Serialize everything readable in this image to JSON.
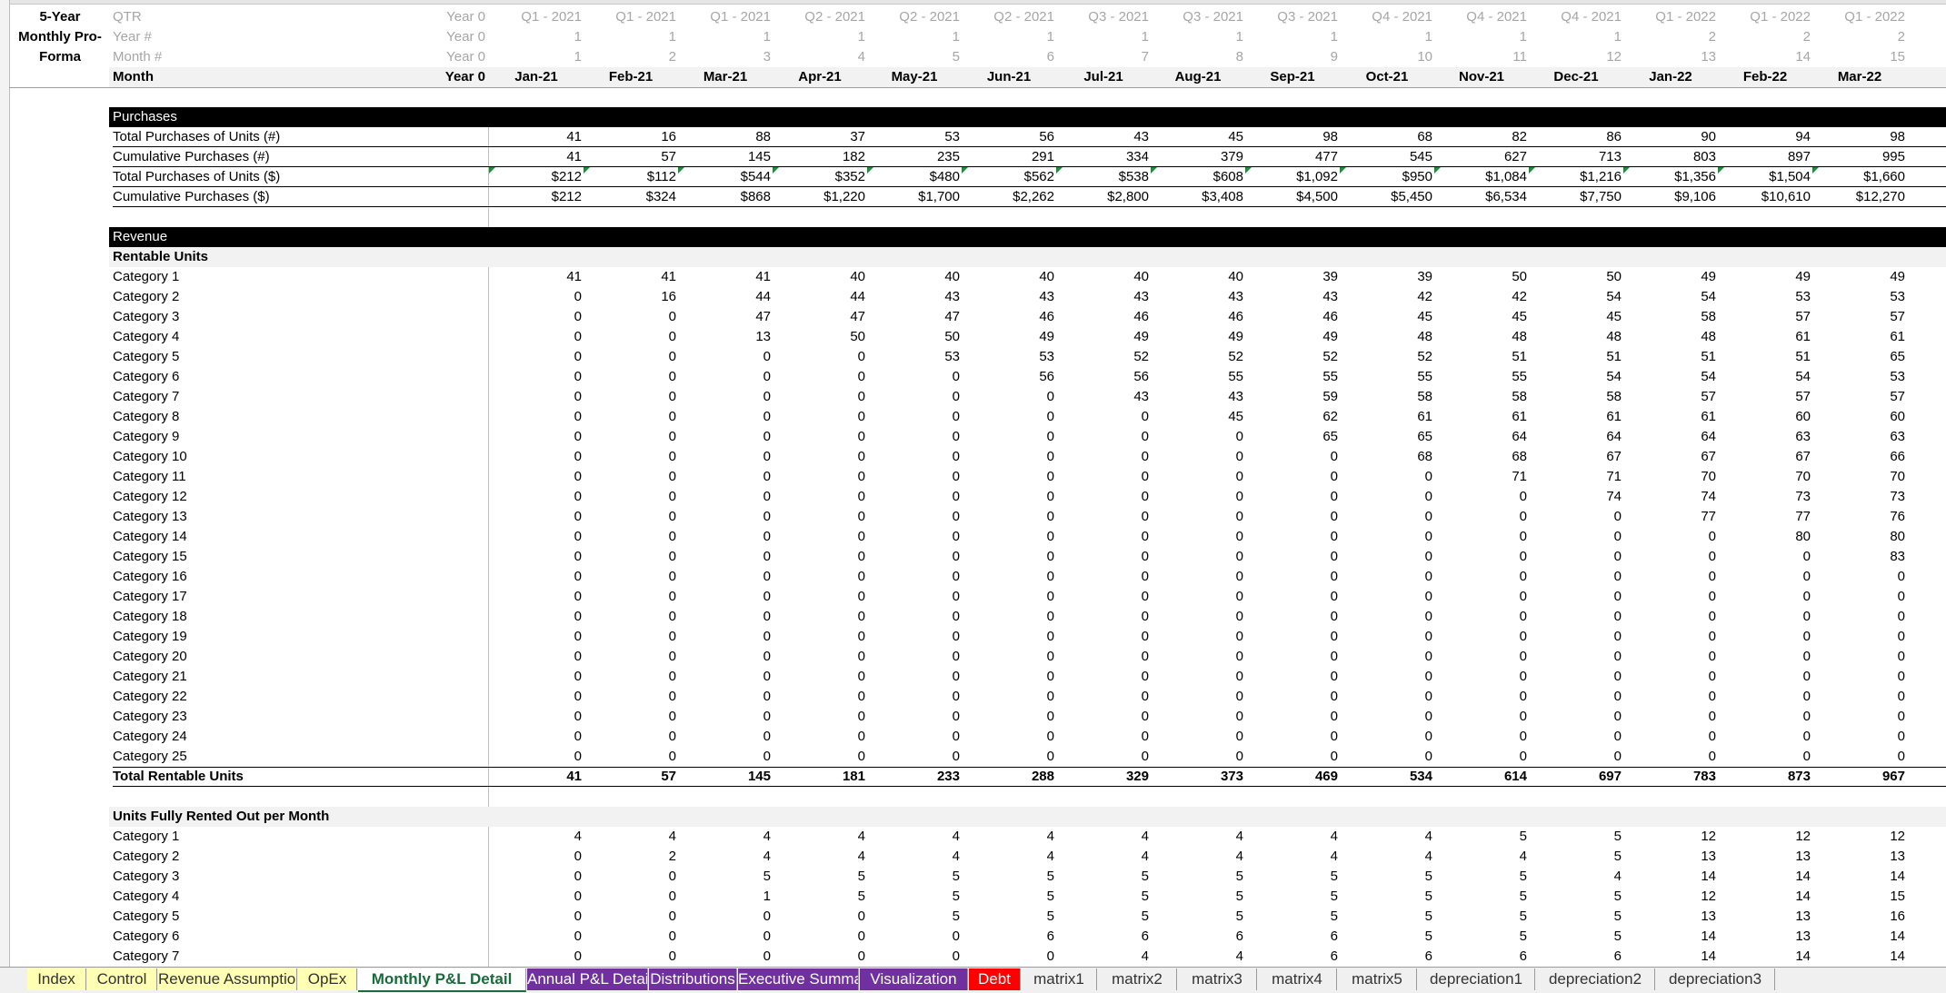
{
  "sheet": {
    "title_lines": [
      "5-Year",
      "Monthly Pro-",
      "Forma"
    ],
    "columns": {
      "qtr": [
        "Year 0",
        "Q1 - 2021",
        "Q1 - 2021",
        "Q1 - 2021",
        "Q2 - 2021",
        "Q2 - 2021",
        "Q2 - 2021",
        "Q3 - 2021",
        "Q3 - 2021",
        "Q3 - 2021",
        "Q4 - 2021",
        "Q4 - 2021",
        "Q4 - 2021",
        "Q1 - 2022",
        "Q1 - 2022",
        "Q1 - 2022"
      ],
      "year": [
        "Year 0",
        "1",
        "1",
        "1",
        "1",
        "1",
        "1",
        "1",
        "1",
        "1",
        "1",
        "1",
        "1",
        "2",
        "2",
        "2"
      ],
      "monthnum": [
        "Year 0",
        "1",
        "2",
        "3",
        "4",
        "5",
        "6",
        "7",
        "8",
        "9",
        "10",
        "11",
        "12",
        "13",
        "14",
        "15"
      ],
      "month": [
        "Year 0",
        "Jan-21",
        "Feb-21",
        "Mar-21",
        "Apr-21",
        "May-21",
        "Jun-21",
        "Jul-21",
        "Aug-21",
        "Sep-21",
        "Oct-21",
        "Nov-21",
        "Dec-21",
        "Jan-22",
        "Feb-22",
        "Mar-22"
      ]
    },
    "header_labels": {
      "qtr": "QTR",
      "year": "Year #",
      "monthnum": "Month #",
      "month": "Month"
    },
    "purchases": {
      "title": "Purchases",
      "rows": [
        {
          "label": "Total Purchases of Units (#)",
          "values": [
            "41",
            "16",
            "88",
            "37",
            "53",
            "56",
            "43",
            "45",
            "98",
            "68",
            "82",
            "86",
            "90",
            "94",
            "98"
          ]
        },
        {
          "label": "Cumulative Purchases (#)",
          "values": [
            "41",
            "57",
            "145",
            "182",
            "235",
            "291",
            "334",
            "379",
            "477",
            "545",
            "627",
            "713",
            "803",
            "897",
            "995"
          ]
        },
        {
          "label": "Total Purchases of Units ($)",
          "values": [
            "$212",
            "$112",
            "$544",
            "$352",
            "$480",
            "$562",
            "$538",
            "$608",
            "$1,092",
            "$950",
            "$1,084",
            "$1,216",
            "$1,356",
            "$1,504",
            "$1,660"
          ]
        },
        {
          "label": "Cumulative Purchases ($)",
          "values": [
            "$212",
            "$324",
            "$868",
            "$1,220",
            "$1,700",
            "$2,262",
            "$2,800",
            "$3,408",
            "$4,500",
            "$5,450",
            "$6,534",
            "$7,750",
            "$9,106",
            "$10,610",
            "$12,270"
          ]
        }
      ]
    },
    "revenue": {
      "title": "Revenue",
      "rentable_title": "Rentable Units",
      "rentable_rows": [
        {
          "label": "Category 1",
          "values": [
            "41",
            "41",
            "41",
            "40",
            "40",
            "40",
            "40",
            "40",
            "39",
            "39",
            "50",
            "50",
            "49",
            "49",
            "49"
          ]
        },
        {
          "label": "Category 2",
          "values": [
            "0",
            "16",
            "44",
            "44",
            "43",
            "43",
            "43",
            "43",
            "43",
            "42",
            "42",
            "54",
            "54",
            "53",
            "53"
          ]
        },
        {
          "label": "Category 3",
          "values": [
            "0",
            "0",
            "47",
            "47",
            "47",
            "46",
            "46",
            "46",
            "46",
            "45",
            "45",
            "45",
            "58",
            "57",
            "57"
          ]
        },
        {
          "label": "Category 4",
          "values": [
            "0",
            "0",
            "13",
            "50",
            "50",
            "49",
            "49",
            "49",
            "49",
            "48",
            "48",
            "48",
            "48",
            "61",
            "61"
          ]
        },
        {
          "label": "Category 5",
          "values": [
            "0",
            "0",
            "0",
            "0",
            "53",
            "53",
            "52",
            "52",
            "52",
            "52",
            "51",
            "51",
            "51",
            "51",
            "65"
          ]
        },
        {
          "label": "Category 6",
          "values": [
            "0",
            "0",
            "0",
            "0",
            "0",
            "56",
            "56",
            "55",
            "55",
            "55",
            "55",
            "54",
            "54",
            "54",
            "53"
          ]
        },
        {
          "label": "Category 7",
          "values": [
            "0",
            "0",
            "0",
            "0",
            "0",
            "0",
            "43",
            "43",
            "59",
            "58",
            "58",
            "58",
            "57",
            "57",
            "57"
          ]
        },
        {
          "label": "Category 8",
          "values": [
            "0",
            "0",
            "0",
            "0",
            "0",
            "0",
            "0",
            "45",
            "62",
            "61",
            "61",
            "61",
            "61",
            "60",
            "60"
          ]
        },
        {
          "label": "Category 9",
          "values": [
            "0",
            "0",
            "0",
            "0",
            "0",
            "0",
            "0",
            "0",
            "65",
            "65",
            "64",
            "64",
            "64",
            "63",
            "63"
          ]
        },
        {
          "label": "Category 10",
          "values": [
            "0",
            "0",
            "0",
            "0",
            "0",
            "0",
            "0",
            "0",
            "0",
            "68",
            "68",
            "67",
            "67",
            "67",
            "66"
          ]
        },
        {
          "label": "Category 11",
          "values": [
            "0",
            "0",
            "0",
            "0",
            "0",
            "0",
            "0",
            "0",
            "0",
            "0",
            "71",
            "71",
            "70",
            "70",
            "70"
          ]
        },
        {
          "label": "Category 12",
          "values": [
            "0",
            "0",
            "0",
            "0",
            "0",
            "0",
            "0",
            "0",
            "0",
            "0",
            "0",
            "74",
            "74",
            "73",
            "73"
          ]
        },
        {
          "label": "Category 13",
          "values": [
            "0",
            "0",
            "0",
            "0",
            "0",
            "0",
            "0",
            "0",
            "0",
            "0",
            "0",
            "0",
            "77",
            "77",
            "76"
          ]
        },
        {
          "label": "Category 14",
          "values": [
            "0",
            "0",
            "0",
            "0",
            "0",
            "0",
            "0",
            "0",
            "0",
            "0",
            "0",
            "0",
            "0",
            "80",
            "80"
          ]
        },
        {
          "label": "Category 15",
          "values": [
            "0",
            "0",
            "0",
            "0",
            "0",
            "0",
            "0",
            "0",
            "0",
            "0",
            "0",
            "0",
            "0",
            "0",
            "83"
          ]
        },
        {
          "label": "Category 16",
          "values": [
            "0",
            "0",
            "0",
            "0",
            "0",
            "0",
            "0",
            "0",
            "0",
            "0",
            "0",
            "0",
            "0",
            "0",
            "0"
          ]
        },
        {
          "label": "Category 17",
          "values": [
            "0",
            "0",
            "0",
            "0",
            "0",
            "0",
            "0",
            "0",
            "0",
            "0",
            "0",
            "0",
            "0",
            "0",
            "0"
          ]
        },
        {
          "label": "Category 18",
          "values": [
            "0",
            "0",
            "0",
            "0",
            "0",
            "0",
            "0",
            "0",
            "0",
            "0",
            "0",
            "0",
            "0",
            "0",
            "0"
          ]
        },
        {
          "label": "Category 19",
          "values": [
            "0",
            "0",
            "0",
            "0",
            "0",
            "0",
            "0",
            "0",
            "0",
            "0",
            "0",
            "0",
            "0",
            "0",
            "0"
          ]
        },
        {
          "label": "Category 20",
          "values": [
            "0",
            "0",
            "0",
            "0",
            "0",
            "0",
            "0",
            "0",
            "0",
            "0",
            "0",
            "0",
            "0",
            "0",
            "0"
          ]
        },
        {
          "label": "Category 21",
          "values": [
            "0",
            "0",
            "0",
            "0",
            "0",
            "0",
            "0",
            "0",
            "0",
            "0",
            "0",
            "0",
            "0",
            "0",
            "0"
          ]
        },
        {
          "label": "Category 22",
          "values": [
            "0",
            "0",
            "0",
            "0",
            "0",
            "0",
            "0",
            "0",
            "0",
            "0",
            "0",
            "0",
            "0",
            "0",
            "0"
          ]
        },
        {
          "label": "Category 23",
          "values": [
            "0",
            "0",
            "0",
            "0",
            "0",
            "0",
            "0",
            "0",
            "0",
            "0",
            "0",
            "0",
            "0",
            "0",
            "0"
          ]
        },
        {
          "label": "Category 24",
          "values": [
            "0",
            "0",
            "0",
            "0",
            "0",
            "0",
            "0",
            "0",
            "0",
            "0",
            "0",
            "0",
            "0",
            "0",
            "0"
          ]
        },
        {
          "label": "Category 25",
          "values": [
            "0",
            "0",
            "0",
            "0",
            "0",
            "0",
            "0",
            "0",
            "0",
            "0",
            "0",
            "0",
            "0",
            "0",
            "0"
          ]
        }
      ],
      "total_rentable": {
        "label": "Total Rentable Units",
        "values": [
          "41",
          "57",
          "145",
          "181",
          "233",
          "288",
          "329",
          "373",
          "469",
          "534",
          "614",
          "697",
          "783",
          "873",
          "967"
        ]
      },
      "fully_rented_title": "Units Fully Rented Out per Month",
      "fully_rented_rows": [
        {
          "label": "Category 1",
          "values": [
            "4",
            "4",
            "4",
            "4",
            "4",
            "4",
            "4",
            "4",
            "4",
            "4",
            "5",
            "5",
            "12",
            "12",
            "12"
          ]
        },
        {
          "label": "Category 2",
          "values": [
            "0",
            "2",
            "4",
            "4",
            "4",
            "4",
            "4",
            "4",
            "4",
            "4",
            "4",
            "5",
            "13",
            "13",
            "13"
          ]
        },
        {
          "label": "Category 3",
          "values": [
            "0",
            "0",
            "5",
            "5",
            "5",
            "5",
            "5",
            "5",
            "5",
            "5",
            "5",
            "4",
            "14",
            "14",
            "14"
          ]
        },
        {
          "label": "Category 4",
          "values": [
            "0",
            "0",
            "1",
            "5",
            "5",
            "5",
            "5",
            "5",
            "5",
            "5",
            "5",
            "5",
            "12",
            "14",
            "15"
          ]
        },
        {
          "label": "Category 5",
          "values": [
            "0",
            "0",
            "0",
            "0",
            "5",
            "5",
            "5",
            "5",
            "5",
            "5",
            "5",
            "5",
            "13",
            "13",
            "16"
          ]
        },
        {
          "label": "Category 6",
          "values": [
            "0",
            "0",
            "0",
            "0",
            "0",
            "6",
            "6",
            "6",
            "6",
            "5",
            "5",
            "5",
            "14",
            "13",
            "14"
          ]
        },
        {
          "label": "Category 7",
          "values": [
            "0",
            "0",
            "0",
            "0",
            "0",
            "0",
            "4",
            "4",
            "6",
            "6",
            "6",
            "6",
            "14",
            "14",
            "14"
          ]
        }
      ]
    }
  },
  "tabs": [
    {
      "label": "Index",
      "color": "#ffffb3"
    },
    {
      "label": "Control",
      "color": "#ffffb3"
    },
    {
      "label": "Revenue Assumptions",
      "color": "#ffffb3"
    },
    {
      "label": "OpEx",
      "color": "#ffffb3"
    },
    {
      "label": "Monthly P&L Detail",
      "color": "#ffffff",
      "active": true
    },
    {
      "label": "Annual P&L Detail",
      "color": "#7030a0"
    },
    {
      "label": "Distributions",
      "color": "#7030a0"
    },
    {
      "label": "Executive Summary",
      "color": "#7030a0"
    },
    {
      "label": "Visualization",
      "color": "#7030a0"
    },
    {
      "label": "Debt",
      "color": "#ff0000"
    },
    {
      "label": "matrix1",
      "color": "#f0f0f0"
    },
    {
      "label": "matrix2",
      "color": "#f0f0f0"
    },
    {
      "label": "matrix3",
      "color": "#f0f0f0"
    },
    {
      "label": "matrix4",
      "color": "#f0f0f0"
    },
    {
      "label": "matrix5",
      "color": "#f0f0f0"
    },
    {
      "label": "depreciation1",
      "color": "#f0f0f0"
    },
    {
      "label": "depreciation2",
      "color": "#f0f0f0"
    },
    {
      "label": "depreciation3",
      "color": "#f0f0f0"
    }
  ]
}
